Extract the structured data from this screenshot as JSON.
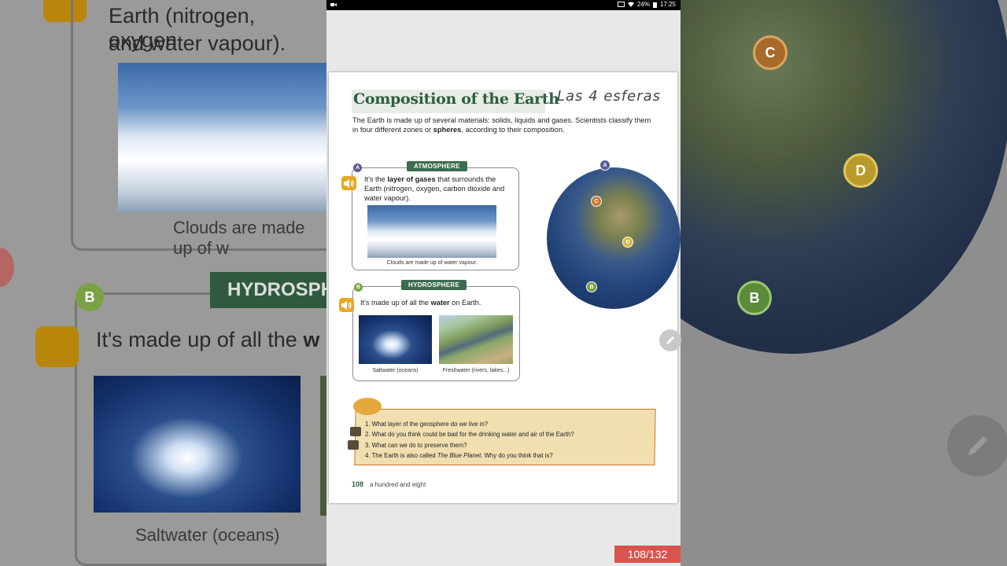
{
  "status_bar": {
    "battery": "24%",
    "time": "17:25"
  },
  "background_left": {
    "line1": "Earth (nitrogen, oxygen",
    "line2": "and water vapour).",
    "caption1": "Clouds are made up of w",
    "label": "HYDROSPHERE",
    "sentence_start": "It's made up of all the ",
    "sentence_bold": "w",
    "caption2": "Saltwater (oceans)",
    "letter_b": "B"
  },
  "background_right": {
    "letter_c": "C",
    "letter_d": "D",
    "letter_b": "B"
  },
  "page": {
    "title": "Composition of the Earth",
    "handwritten_note": "Las 4 esferas",
    "intro_part1": "The Earth is made up of several materials: solids, liquids and gases. Scientists classify them in four different zones or ",
    "intro_bold": "spheres",
    "intro_part2": ", according to their composition.",
    "atmosphere": {
      "letter": "A",
      "label": "ATMOSPHERE",
      "text_pre": "It's the ",
      "text_bold": "layer of gases",
      "text_post": " that surrounds the Earth (nitrogen, oxygen, carbon dioxide and water vapour).",
      "caption": "Clouds are made up of water vapour."
    },
    "hydrosphere": {
      "letter": "B",
      "label": "HYDROSPHERE",
      "text_pre": "It's made up of all the ",
      "text_bold": "water",
      "text_post": " on Earth.",
      "caption_salt": "Saltwater (oceans)",
      "caption_fresh": "Freshwater (rivers, lakes...)"
    },
    "globe_labels": {
      "a": "A",
      "c": "C",
      "d": "D",
      "b": "B"
    },
    "questions": {
      "q1": "1. What layer of the geosphere do we live in?",
      "q2": "2. What do you think could be bad for the drinking water and air of the Earth?",
      "q3": "3. What can we do to preserve them?",
      "q4_pre": "4. The Earth is also called ",
      "q4_italic": "The Blue Planet",
      "q4_post": ". Why do you think that is?"
    },
    "page_number": "108",
    "page_number_text": "a hundred and eight"
  },
  "page_counter": "108/132",
  "colors": {
    "accent_green": "#3d6b4f",
    "speaker_yellow": "#e8a823",
    "counter_red": "#d9534f"
  }
}
